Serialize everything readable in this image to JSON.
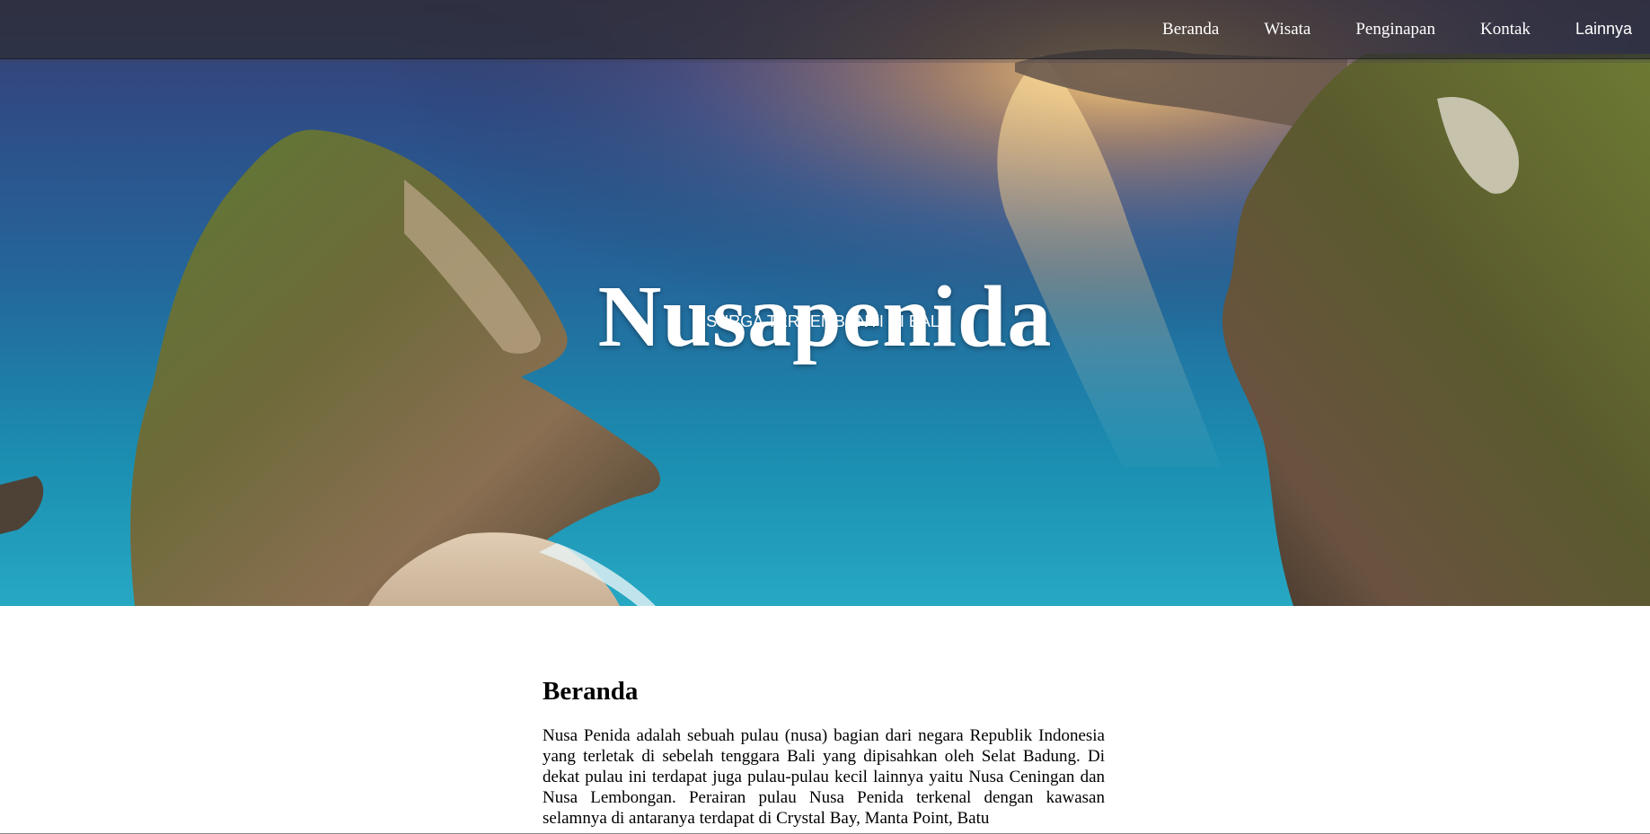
{
  "navbar": {
    "items": [
      {
        "label": "Beranda"
      },
      {
        "label": "Wisata"
      },
      {
        "label": "Penginapan"
      },
      {
        "label": "Kontak"
      },
      {
        "label": "Lainnya"
      }
    ]
  },
  "hero": {
    "title": "Nusapenida",
    "subtitle": "SURGA TERSEMBUNYI DI BALI"
  },
  "main": {
    "heading": "Beranda",
    "paragraph": "Nusa Penida adalah sebuah pulau (nusa) bagian dari negara Republik Indonesia yang terletak di sebelah tenggara Bali yang dipisahkan oleh Selat Badung. Di dekat pulau ini terdapat juga pulau-pulau kecil lainnya yaitu Nusa Ceningan dan Nusa Lembongan. Perairan pulau Nusa Penida terkenal dengan kawasan selamnya di antaranya terdapat di Crystal Bay, Manta Point, Batu"
  },
  "colors": {
    "navbar_bg": "#28282c",
    "text_light": "#ffffff",
    "text_dark": "#000000",
    "page_bg": "#ffffff"
  }
}
